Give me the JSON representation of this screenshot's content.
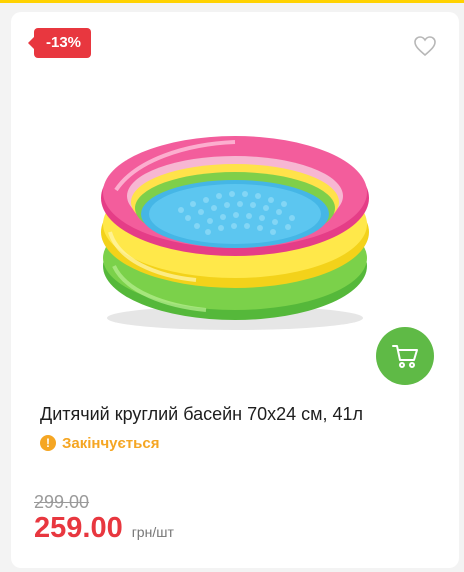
{
  "product": {
    "discount": "-13%",
    "title": "Дитячий круглий басейн 70х24 см, 41л",
    "stock_status": "Закінчується",
    "old_price": "299.00",
    "price": "259.00",
    "unit": "грн/шт"
  },
  "icons": {
    "favorite": "heart-outline-icon",
    "cart": "cart-icon",
    "stock": "exclamation-circle-icon"
  },
  "colors": {
    "accent_top": "#ffd200",
    "discount": "#e8373f",
    "price": "#e8373f",
    "cart_button": "#5fba46",
    "stock_warning": "#f5a623"
  }
}
